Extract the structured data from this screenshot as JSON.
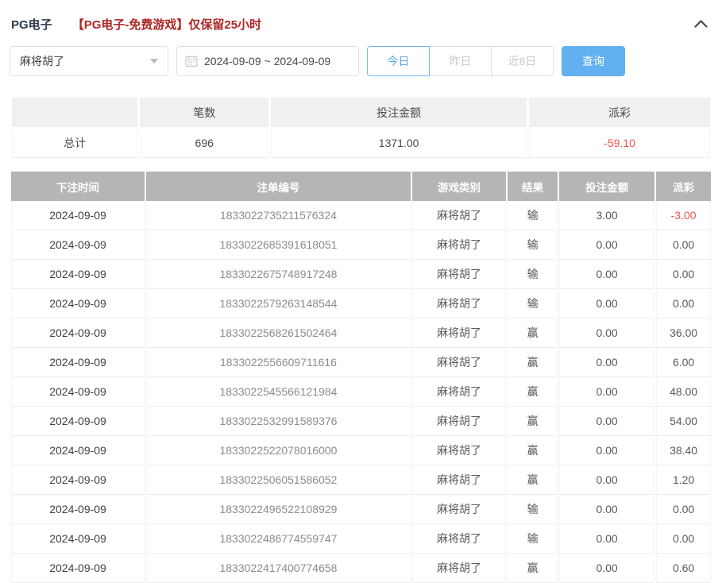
{
  "header": {
    "title": "PG电子",
    "notice": "【PG电子-免费游戏】仅保留25小时",
    "collapse_icon": "chevron-up"
  },
  "filters": {
    "game_select": {
      "value": "麻将胡了",
      "caret_icon": "caret-down"
    },
    "date_range": {
      "value": "2024-09-09 ~ 2024-09-09",
      "icon": "calendar"
    },
    "quick_buttons": [
      {
        "label": "今日",
        "active": true
      },
      {
        "label": "昨日",
        "active": false
      },
      {
        "label": "近8日",
        "active": false
      }
    ],
    "search_label": "查询"
  },
  "summary": {
    "columns": {
      "label": "",
      "count": "笔数",
      "bet_amount": "投注金额",
      "payout": "派彩"
    },
    "row": {
      "label": "总计",
      "count": "696",
      "bet_amount": "1371.00",
      "payout": "-59.10"
    }
  },
  "records": {
    "columns": [
      "下注时间",
      "注单编号",
      "游戏类别",
      "结果",
      "投注金额",
      "派彩"
    ],
    "rows": [
      [
        "2024-09-09",
        "1833022735211576324",
        "麻将胡了",
        "输",
        "3.00",
        "-3.00"
      ],
      [
        "2024-09-09",
        "1833022685391618051",
        "麻将胡了",
        "输",
        "0.00",
        "0.00"
      ],
      [
        "2024-09-09",
        "1833022675748917248",
        "麻将胡了",
        "输",
        "0.00",
        "0.00"
      ],
      [
        "2024-09-09",
        "1833022579263148544",
        "麻将胡了",
        "输",
        "0.00",
        "0.00"
      ],
      [
        "2024-09-09",
        "1833022568261502464",
        "麻将胡了",
        "赢",
        "0.00",
        "36.00"
      ],
      [
        "2024-09-09",
        "1833022556609711616",
        "麻将胡了",
        "赢",
        "0.00",
        "6.00"
      ],
      [
        "2024-09-09",
        "1833022545566121984",
        "麻将胡了",
        "赢",
        "0.00",
        "48.00"
      ],
      [
        "2024-09-09",
        "1833022532991589376",
        "麻将胡了",
        "赢",
        "0.00",
        "54.00"
      ],
      [
        "2024-09-09",
        "1833022522078016000",
        "麻将胡了",
        "赢",
        "0.00",
        "38.40"
      ],
      [
        "2024-09-09",
        "1833022506051586052",
        "麻将胡了",
        "赢",
        "0.00",
        "1.20"
      ],
      [
        "2024-09-09",
        "1833022496522108929",
        "麻将胡了",
        "输",
        "0.00",
        "0.00"
      ],
      [
        "2024-09-09",
        "1833022486774559747",
        "麻将胡了",
        "输",
        "0.00",
        "0.00"
      ],
      [
        "2024-09-09",
        "1833022417400774658",
        "麻将胡了",
        "赢",
        "0.00",
        "0.60"
      ]
    ]
  },
  "colors": {
    "accent_blue": "#63b0f1",
    "active_blue_text": "#58a8eb",
    "negative_red": "#ef5350",
    "notice_red": "#ae2626",
    "table_header_gray": "#b5b5b5"
  }
}
